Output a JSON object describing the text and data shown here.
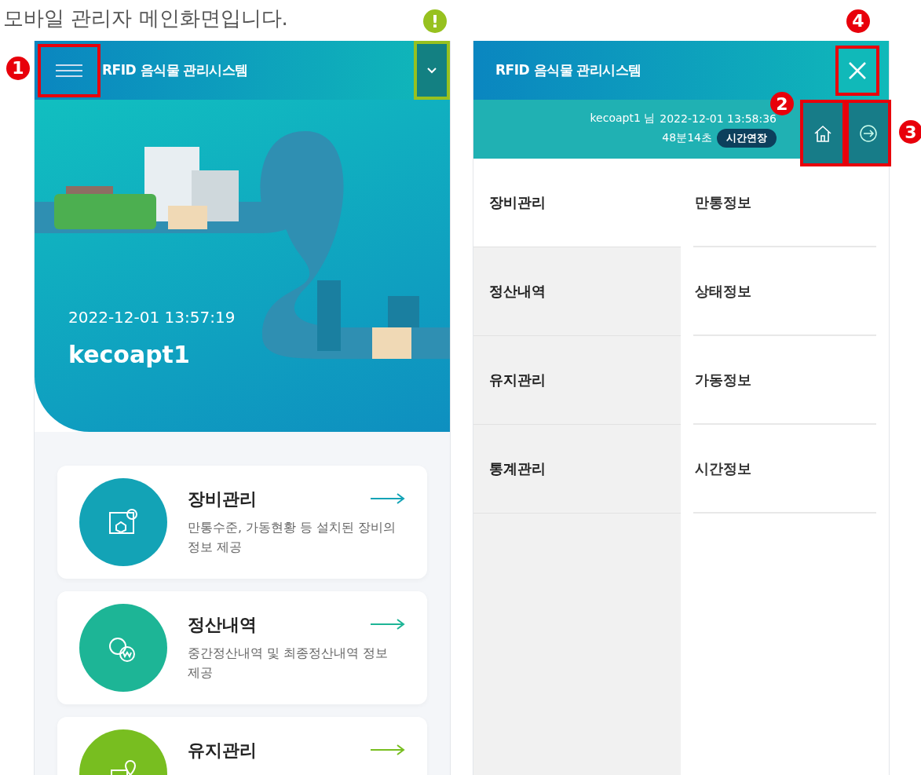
{
  "caption": "모바일 관리자 메인화면입니다.",
  "callouts": [
    {
      "label": "1",
      "color": "#e8000b"
    },
    {
      "label": "2",
      "color": "#e8000b"
    },
    {
      "label": "3",
      "color": "#e8000b"
    },
    {
      "label": "4",
      "color": "#e8000b"
    },
    {
      "label": "!",
      "color": "#97c11f"
    }
  ],
  "main_screen": {
    "title": "RFID 음식물 관리시스템",
    "datetime": "2022-12-01 13:57:19",
    "user": "kecoapt1",
    "cards": [
      {
        "title": "장비관리",
        "description": "만통수준, 가동현황 등 설치된 장비의 정보 제공",
        "color": "#13a3b6"
      },
      {
        "title": "정산내역",
        "description": "중간정산내역 및 최종정산내역 정보제공",
        "color": "#1db596"
      },
      {
        "title": "유지관리",
        "color": "#78be20"
      }
    ]
  },
  "menu_screen": {
    "title": "RFID 음식물 관리시스템",
    "user": "kecoapt1 님",
    "datetime": "2022-12-01 13:58:36",
    "remaining": "48분14초",
    "extend_button": "시간연장",
    "categories": [
      {
        "label": "장비관리",
        "selected": true
      },
      {
        "label": "정산내역",
        "selected": false
      },
      {
        "label": "유지관리",
        "selected": false
      },
      {
        "label": "통계관리",
        "selected": false
      }
    ],
    "subitems": [
      "만통정보",
      "상태정보",
      "가동정보",
      "시간정보"
    ]
  }
}
